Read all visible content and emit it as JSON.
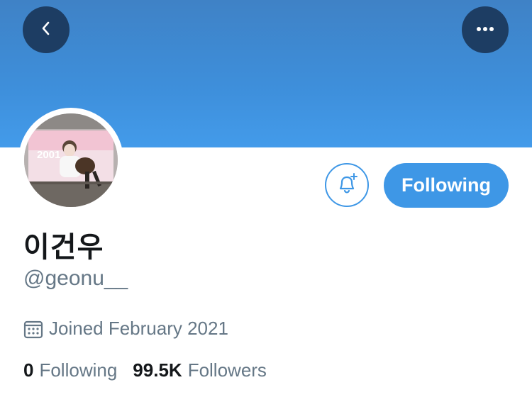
{
  "header": {
    "back_icon": "chevron-left-icon",
    "more_icon": "ellipsis-icon",
    "banner_color": "#3e8fdb"
  },
  "profile": {
    "display_name": "이건우",
    "handle": "@geonu__",
    "joined": "Joined February 2021",
    "joined_icon": "calendar-icon",
    "avatar_banner_text": "2001"
  },
  "actions": {
    "notify_icon": "bell-plus-icon",
    "follow_label": "Following",
    "accent_color": "#3e97e6"
  },
  "stats": {
    "following_count": "0",
    "following_label": "Following",
    "followers_count": "99.5K",
    "followers_label": "Followers"
  }
}
